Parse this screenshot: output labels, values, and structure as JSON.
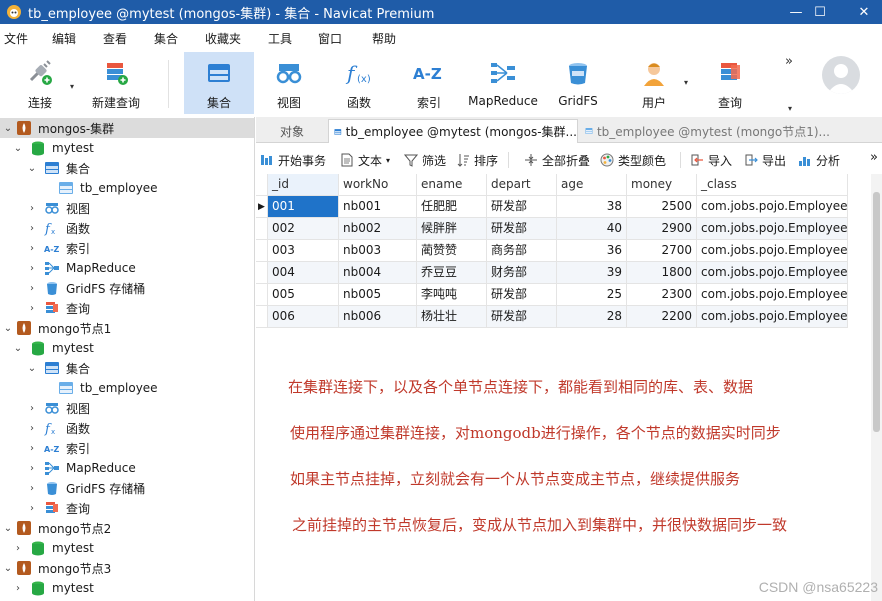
{
  "window": {
    "title": "tb_employee @mytest (mongos-集群) - 集合 - Navicat Premium",
    "minimize": "—",
    "maximize": "☐",
    "close": "✕"
  },
  "menu": [
    "文件",
    "编辑",
    "查看",
    "集合",
    "收藏夹",
    "工具",
    "窗口",
    "帮助"
  ],
  "toolbar": {
    "connect": "连接",
    "new_query": "新建查询",
    "collection": "集合",
    "view": "视图",
    "function": "函数",
    "index": "索引",
    "mapreduce": "MapReduce",
    "gridfs": "GridFS",
    "user": "用户",
    "query": "查询",
    "more": "»"
  },
  "sidebar": {
    "connections": [
      {
        "name": "mongos-集群",
        "expanded": true,
        "selected": true,
        "db": "mytest",
        "collections_label": "集合",
        "collection": "tb_employee",
        "items": [
          "视图",
          "函数",
          "索引",
          "MapReduce",
          "GridFS 存储桶",
          "查询"
        ]
      },
      {
        "name": "mongo节点1",
        "expanded": true,
        "selected": false,
        "db": "mytest",
        "collections_label": "集合",
        "collection": "tb_employee",
        "items": [
          "视图",
          "函数",
          "索引",
          "MapReduce",
          "GridFS 存储桶",
          "查询"
        ]
      },
      {
        "name": "mongo节点2",
        "expanded": true,
        "db": "mytest"
      },
      {
        "name": "mongo节点3",
        "expanded": true,
        "db": "mytest"
      }
    ]
  },
  "tabs": {
    "objects": "对象",
    "tab1": "tb_employee @mytest (mongos-集群...",
    "tab2": "tb_employee @mytest (mongo节点1)..."
  },
  "data_toolbar": {
    "begin_transaction": "开始事务",
    "text": "文本",
    "filter": "筛选",
    "sort": "排序",
    "collapse_all": "全部折叠",
    "type_color": "类型颜色",
    "import": "导入",
    "export": "导出",
    "analyze": "分析",
    "more": "»"
  },
  "grid": {
    "columns": [
      "_id",
      "workNo",
      "ename",
      "depart",
      "age",
      "money",
      "_class"
    ],
    "rows": [
      [
        "001",
        "nb001",
        "任肥肥",
        "研发部",
        "38",
        "2500",
        "com.jobs.pojo.Employee"
      ],
      [
        "002",
        "nb002",
        "候胖胖",
        "研发部",
        "40",
        "2900",
        "com.jobs.pojo.Employee"
      ],
      [
        "003",
        "nb003",
        "蔺赞赞",
        "商务部",
        "36",
        "2700",
        "com.jobs.pojo.Employee"
      ],
      [
        "004",
        "nb004",
        "乔豆豆",
        "财务部",
        "39",
        "1800",
        "com.jobs.pojo.Employee"
      ],
      [
        "005",
        "nb005",
        "李吨吨",
        "研发部",
        "25",
        "2300",
        "com.jobs.pojo.Employee"
      ],
      [
        "006",
        "nb006",
        "杨壮壮",
        "研发部",
        "28",
        "2200",
        "com.jobs.pojo.Employee"
      ]
    ],
    "selected_cell": "001"
  },
  "notes": [
    "在集群连接下，以及各个单节点连接下，都能看到相同的库、表、数据",
    "使用程序通过集群连接，对mongodb进行操作，各个节点的数据实时同步",
    "如果主节点挂掉，立刻就会有一个从节点变成主节点，继续提供服务",
    "之前挂掉的主节点恢复后，变成从节点加入到集群中，并很快数据同步一致"
  ],
  "watermark": "CSDN @nsa65223",
  "colors": {
    "titlebar": "#1f5ca8",
    "selection": "#1f73c9",
    "note_text": "#c0392b",
    "toolbar_active": "#cfe1f7"
  }
}
